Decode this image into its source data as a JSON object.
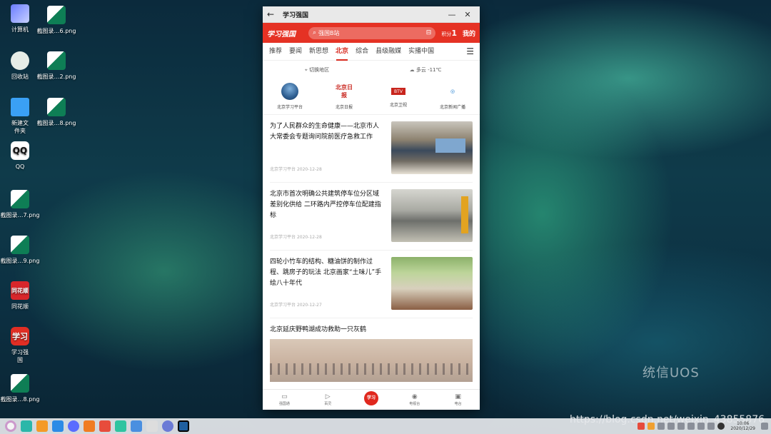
{
  "desktop": {
    "icons": [
      {
        "label": "计算机",
        "glyph": "computer"
      },
      {
        "label": "回收站",
        "glyph": "trash"
      },
      {
        "label": "新建文件夹",
        "glyph": "folder"
      },
      {
        "label": "QQ",
        "glyph": "qq"
      },
      {
        "label": "截图录…7.png",
        "glyph": "shot"
      },
      {
        "label": "截图录…9.png",
        "glyph": "shot"
      },
      {
        "label": "同花顺",
        "glyph": "red"
      },
      {
        "label": "学习强国",
        "glyph": "xxqg"
      },
      {
        "label": "截图录…8.png",
        "glyph": "shot"
      },
      {
        "label": "截图录…6.png",
        "glyph": "shot"
      },
      {
        "label": "截图录…2.png",
        "glyph": "shot"
      },
      {
        "label": "截图录…8.png",
        "glyph": "shot"
      }
    ],
    "qq_glyph": "QQ",
    "ths_glyph": "同花顺",
    "xxqg_glyph": "学习",
    "uos_logo": "统信UOS",
    "watermark": "https://blog.csdn.net/weixin_43855876",
    "clock_time": "10:06",
    "clock_date": "2020/12/29"
  },
  "window": {
    "title": "学习强国",
    "back_icon": "←",
    "minimize_icon": "—",
    "close_icon": "✕"
  },
  "appbar": {
    "logo": "学习强国",
    "search_placeholder": "强国B站",
    "score": "1",
    "score_prefix": "积分",
    "mine": "我的"
  },
  "tabs": {
    "items": [
      "推荐",
      "要闻",
      "新思想",
      "北京",
      "综合",
      "县级融媒",
      "实播中国"
    ],
    "active": "北京"
  },
  "local": {
    "switch_region": "切换地区",
    "weather": "多云 -11℃"
  },
  "channels": [
    {
      "label": "北京学习平台",
      "glyph": ""
    },
    {
      "label": "北京日报",
      "glyph": "北京日报"
    },
    {
      "label": "北京卫视",
      "glyph": "BTV"
    },
    {
      "label": "北京新闻广播",
      "glyph": "◎"
    }
  ],
  "articles": [
    {
      "headline": "为了人民群众的生命健康——北京市人大常委会专题询问院前医疗急救工作",
      "source": "北京学习平台",
      "date": "2020-12-28"
    },
    {
      "headline": "北京市首次明确公共建筑停车位分区域差别化供给 二环路内严控停车位配建指标",
      "source": "北京学习平台",
      "date": "2020-12-28"
    },
    {
      "headline": "四轮小竹车的结构、糖油饼的制作过程、跳房子的玩法 北京画家“土味儿”手绘八十年代",
      "source": "北京学习平台",
      "date": "2020-12-27"
    }
  ],
  "big_article": {
    "headline": "北京延庆野鸭湖成功救助一只灰鹤"
  },
  "bottom_nav": [
    {
      "label": "强国通",
      "icon": "▭"
    },
    {
      "label": "百灵",
      "icon": "▷"
    },
    {
      "label": "",
      "icon": "学习"
    },
    {
      "label": "电视台",
      "icon": "◉"
    },
    {
      "label": "电台",
      "icon": "▣"
    }
  ]
}
